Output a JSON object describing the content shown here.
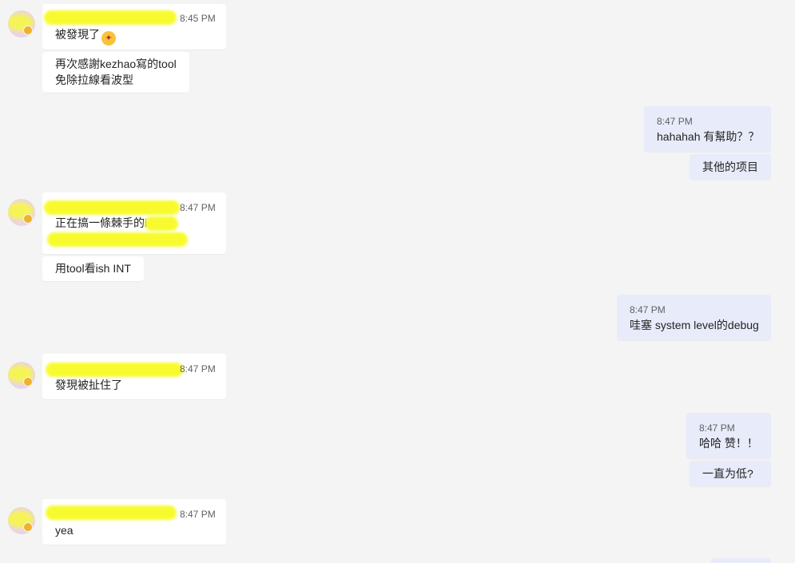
{
  "messages": {
    "m1": {
      "time": "8:45 PM",
      "text": "被發現了",
      "emoji": "starstruck-emoji"
    },
    "m1b": {
      "line1": "再次感謝kezhao寫的tool",
      "line2": "免除拉線看波型"
    },
    "r1": {
      "time": "8:47 PM",
      "text": "hahahah 有幫助？？"
    },
    "r1b": {
      "text": "其他的项目"
    },
    "m2": {
      "time": "8:47 PM",
      "text": "正在搞一條棘手的i"
    },
    "m2b": {
      "text": "用tool看ish INT"
    },
    "r2": {
      "time": "8:47 PM",
      "text": "哇塞 system level的debug"
    },
    "m3": {
      "time": "8:47 PM",
      "text": "發現被扯住了"
    },
    "r3": {
      "time": "8:47 PM",
      "text": "哈哈 赞！！"
    },
    "r3b": {
      "text": "一直为低?"
    },
    "m4": {
      "time": "8:47 PM",
      "text": "yea"
    }
  },
  "colors": {
    "background": "#f4f4f4",
    "incoming_bubble": "#ffffff",
    "outgoing_bubble": "#e8ebfa",
    "redaction_highlight": "#f7fb2e"
  }
}
